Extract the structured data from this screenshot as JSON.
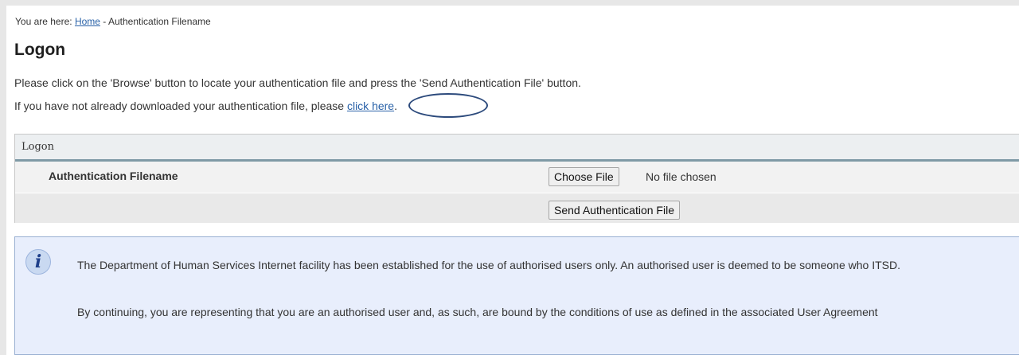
{
  "breadcrumb": {
    "prefix": "You are here: ",
    "home_link": "Home",
    "separator": " - ",
    "current": "Authentication Filename"
  },
  "page_title": "Logon",
  "instructions": "Please click on the 'Browse' button to locate your authentication file and press the 'Send Authentication File' button.",
  "download_prompt": {
    "text_before": "If you have not already downloaded your authentication file, please ",
    "link_text": "click here",
    "text_after": "."
  },
  "logon_panel": {
    "header": "Logon",
    "field_label": "Authentication Filename",
    "choose_file_button": "Choose File",
    "no_file_text": "No file chosen",
    "send_button": "Send Authentication File"
  },
  "notice": {
    "icon": "info-icon",
    "icon_glyph": "i",
    "paragraph1": "The Department of Human Services Internet facility has been established for the use of authorised users only. An authorised user is deemed to be someone who ITSD.",
    "paragraph2": "By continuing, you are representing that you are an authorised user and, as such, are bound by the conditions of use as defined in the associated User Agreement"
  },
  "colors": {
    "link": "#2a62a8",
    "annotation_circle": "#2c4a7c",
    "panel_rule": "#7f9aa6",
    "notice_bg": "#e8eefc"
  }
}
